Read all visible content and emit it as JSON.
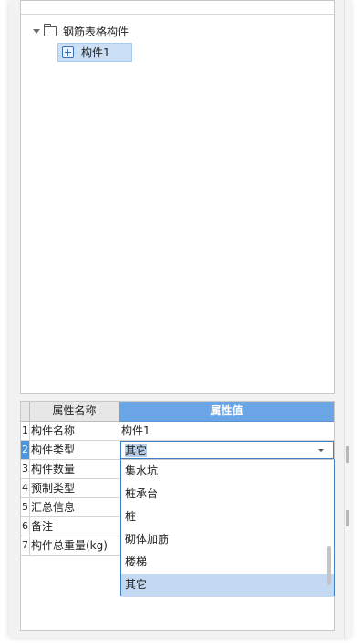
{
  "tree": {
    "root_label": "钢筋表格构件",
    "child_label": "构件1"
  },
  "properties": {
    "header_name": "属性名称",
    "header_value": "属性值",
    "rows": [
      {
        "num": "1",
        "name": "构件名称",
        "value": "构件1"
      },
      {
        "num": "2",
        "name": "构件类型",
        "value": "其它"
      },
      {
        "num": "3",
        "name": "构件数量",
        "value": ""
      },
      {
        "num": "4",
        "name": "预制类型",
        "value": ""
      },
      {
        "num": "5",
        "name": "汇总信息",
        "value": ""
      },
      {
        "num": "6",
        "name": "备注",
        "value": ""
      },
      {
        "num": "7",
        "name": "构件总重量(kg)",
        "value": ""
      }
    ],
    "active_row": 2
  },
  "dropdown": {
    "selected": "其它",
    "options": [
      "集水坑",
      "桩承台",
      "桩",
      "砌体加筋",
      "楼梯",
      "其它"
    ]
  },
  "colors": {
    "header_value_bg": "#6aa6e6",
    "selection_bg": "#c3d9f1",
    "accent_border": "#3f7fc8"
  }
}
